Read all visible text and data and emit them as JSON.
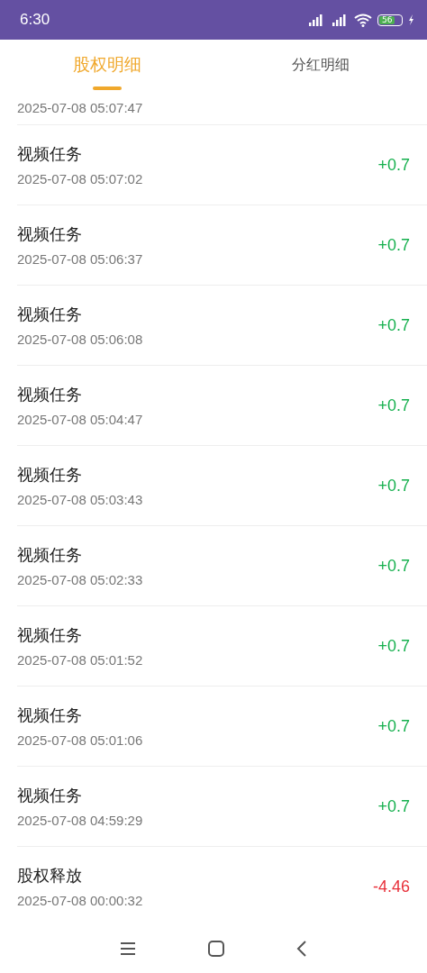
{
  "status_bar": {
    "time": "6:30",
    "battery": "56"
  },
  "tabs": [
    {
      "label": "股权明细",
      "selected": true
    },
    {
      "label": "分红明细",
      "selected": false
    }
  ],
  "records": [
    {
      "date": "2025-07-08 05:07:47"
    },
    {
      "title": "视频任务",
      "date": "2025-07-08 05:07:02",
      "amount": "+0.7",
      "kind": "credit"
    },
    {
      "title": "视频任务",
      "date": "2025-07-08 05:06:37",
      "amount": "+0.7",
      "kind": "credit"
    },
    {
      "title": "视频任务",
      "date": "2025-07-08 05:06:08",
      "amount": "+0.7",
      "kind": "credit"
    },
    {
      "title": "视频任务",
      "date": "2025-07-08 05:04:47",
      "amount": "+0.7",
      "kind": "credit"
    },
    {
      "title": "视频任务",
      "date": "2025-07-08 05:03:43",
      "amount": "+0.7",
      "kind": "credit"
    },
    {
      "title": "视频任务",
      "date": "2025-07-08 05:02:33",
      "amount": "+0.7",
      "kind": "credit"
    },
    {
      "title": "视频任务",
      "date": "2025-07-08 05:01:52",
      "amount": "+0.7",
      "kind": "credit"
    },
    {
      "title": "视频任务",
      "date": "2025-07-08 05:01:06",
      "amount": "+0.7",
      "kind": "credit"
    },
    {
      "title": "视频任务",
      "date": "2025-07-08 04:59:29",
      "amount": "+0.7",
      "kind": "credit"
    },
    {
      "title": "股权释放",
      "date": "2025-07-08 00:00:32",
      "amount": "-4.46",
      "kind": "debit"
    }
  ]
}
